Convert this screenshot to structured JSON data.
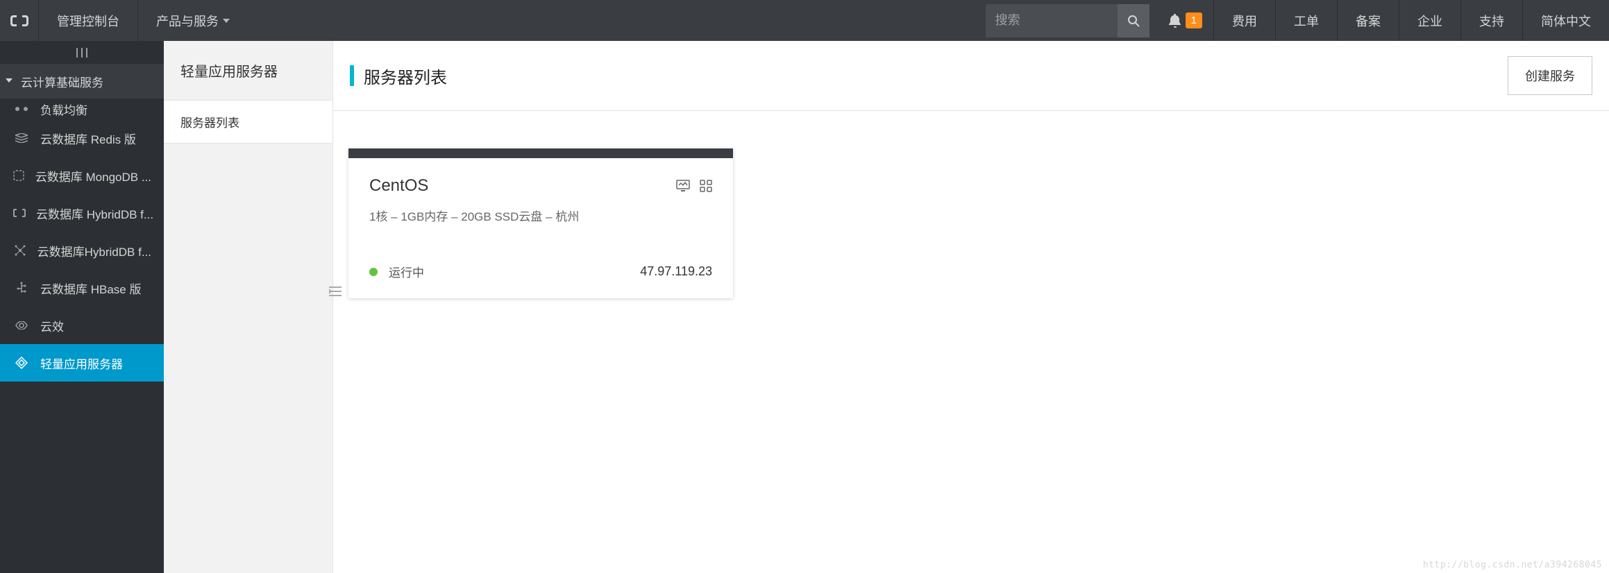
{
  "topbar": {
    "console_label": "管理控制台",
    "products_label": "产品与服务",
    "search_placeholder": "搜索",
    "badge_count": "1",
    "links": {
      "fee": "费用",
      "ticket": "工单",
      "record": "备案",
      "enterprise": "企业",
      "support": "支持",
      "lang": "简体中文"
    }
  },
  "sidebar1": {
    "section": "云计算基础服务",
    "items": [
      {
        "label": "负载均衡"
      },
      {
        "label": "云数据库 Redis 版"
      },
      {
        "label": "云数据库 MongoDB ..."
      },
      {
        "label": "云数据库 HybridDB f..."
      },
      {
        "label": "云数据库HybridDB f..."
      },
      {
        "label": "云数据库 HBase 版"
      },
      {
        "label": "云效"
      },
      {
        "label": "轻量应用服务器"
      }
    ]
  },
  "sidebar2": {
    "title": "轻量应用服务器",
    "subitem": "服务器列表"
  },
  "main": {
    "title": "服务器列表",
    "create_label": "创建服务"
  },
  "card": {
    "name": "CentOS",
    "spec": "1核 – 1GB内存 – 20GB SSD云盘 – 杭州",
    "status": "运行中",
    "ip": "47.97.119.23"
  },
  "watermark": "http://blog.csdn.net/a394268045"
}
